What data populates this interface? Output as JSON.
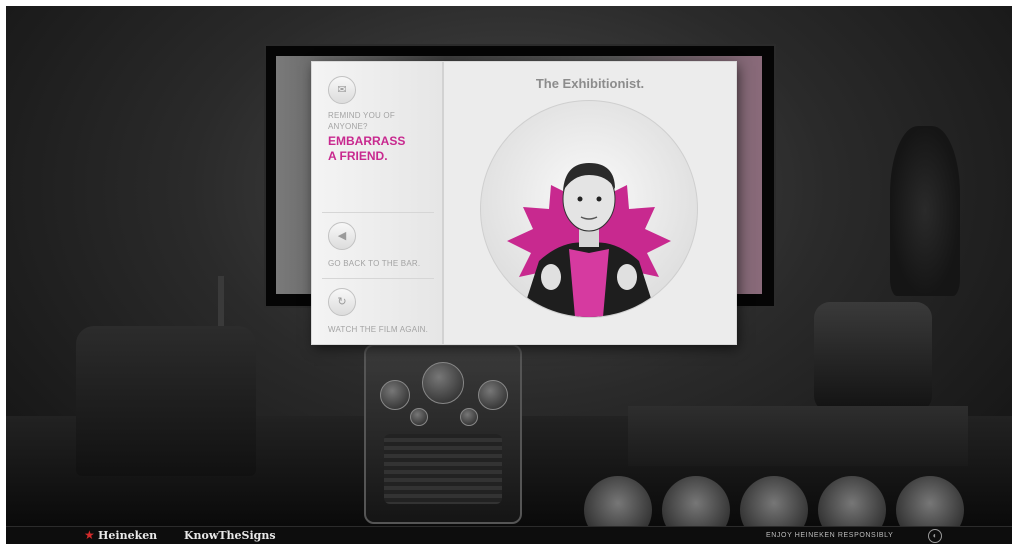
{
  "popup": {
    "title": "The Exhibitionist.",
    "remind_label_line1": "REMIND YOU OF",
    "remind_label_line2": "ANYONE?",
    "embarrass_line1": "EMBARRASS",
    "embarrass_line2": "A FRIEND.",
    "back_label": "GO BACK TO THE BAR.",
    "watch_label": "WATCH THE FILM AGAIN."
  },
  "footer": {
    "brand": "Heineken",
    "tagline": "KnowTheSigns",
    "responsibly": "ENJOY HEINEKEN RESPONSIBLY"
  },
  "colors": {
    "accent": "#c8298f",
    "brand_star": "#d42b2b"
  },
  "icons": {
    "mail": "mail-icon",
    "back": "back-arrow-icon",
    "replay": "replay-icon",
    "star": "star-icon"
  }
}
